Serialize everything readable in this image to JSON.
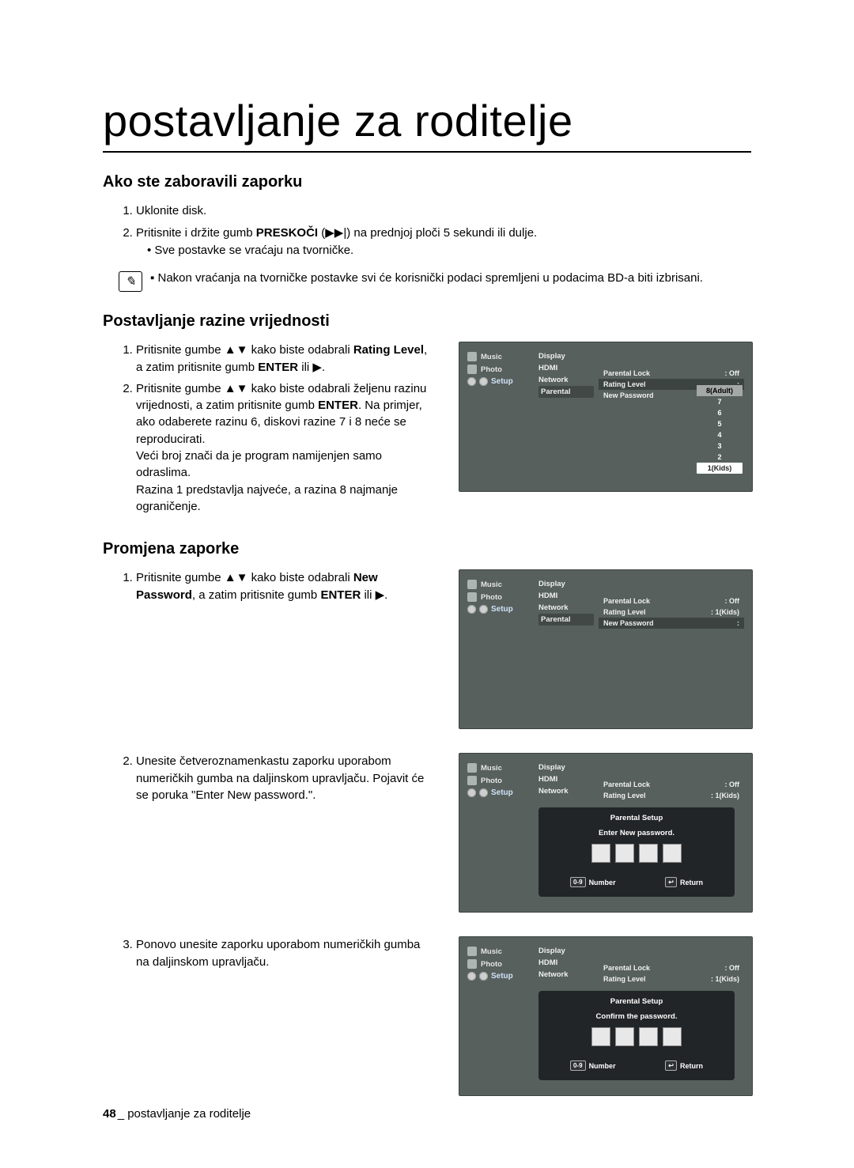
{
  "page": {
    "title": "postavljanje za roditelje",
    "number": "48",
    "footer_text": "postavljanje za roditelje"
  },
  "section1": {
    "heading": "Ako ste zaboravili zaporku",
    "step1": "Uklonite disk.",
    "step2_pre": "Pritisnite i držite gumb ",
    "step2_btn": "PRESKOČI",
    "step2_sym": " (▶▶|) ",
    "step2_post": "na prednjoj ploči 5 sekundi ili dulje.",
    "step2_sub": "Sve postavke se vraćaju na tvorničke.",
    "note": "Nakon vraćanja na tvorničke postavke svi će korisnički podaci spremljeni u podacima BD-a biti izbrisani."
  },
  "section2": {
    "heading": "Postavljanje razine vrijednosti",
    "s1_pre": "Pritisnite gumbe ▲▼ kako biste odabrali ",
    "s1_b": "Rating Level",
    "s1_post": ", a zatim pritisnite gumb ",
    "s1_b2": "ENTER",
    "s1_post2": " ili ▶.",
    "s2_p1": "Pritisnite gumbe ▲▼ kako biste odabrali željenu razinu vrijednosti, a zatim pritisnite gumb ",
    "s2_b": "ENTER",
    "s2_p2": ". Na primjer, ako odaberete razinu 6, diskovi razine 7 i 8 neće se reproducirati.",
    "extra1": "Veći broj znači da je program namijenjen samo odraslima.",
    "extra2": "Razina 1 predstavlja najveće, a razina 8 najmanje ograničenje."
  },
  "section3": {
    "heading": "Promjena zaporke",
    "s1_pre": "Pritisnite gumbe ▲▼ kako biste odabrali ",
    "s1_b": "New Password",
    "s1_post": ", a zatim pritisnite gumb ",
    "s1_b2": "ENTER",
    "s1_post2": " ili ▶.",
    "s2": "Unesite četveroznamenkastu zaporku uporabom numeričkih gumba na daljinskom upravljaču. Pojavit će se poruka \"Enter New password.\".",
    "s3": "Ponovo unesite zaporku uporabom numeričkih gumba na daljinskom upravljaču."
  },
  "tv": {
    "side_music": "Music",
    "side_photo": "Photo",
    "side_setup": "Setup",
    "m_display": "Display",
    "m_hdmi": "HDMI",
    "m_network": "Network",
    "m_parental": "Parental",
    "r_parental_lock": "Parental Lock",
    "r_off": "Off",
    "r_rating": "Rating Level",
    "r_rating_val": "1(Kids)",
    "r_newpw": "New Password",
    "dd8": "8(Adult)",
    "dd7": "7",
    "dd6": "6",
    "dd5": "5",
    "dd4": "4",
    "dd3": "3",
    "dd2": "2",
    "dd1": "1(Kids)"
  },
  "modal": {
    "title": "Parental Setup",
    "enter_prompt": "Enter New password.",
    "confirm_prompt": "Confirm the password.",
    "btn_number": "Number",
    "btn_return": "Return",
    "chip_num": "0-9",
    "chip_ret": "↩"
  }
}
